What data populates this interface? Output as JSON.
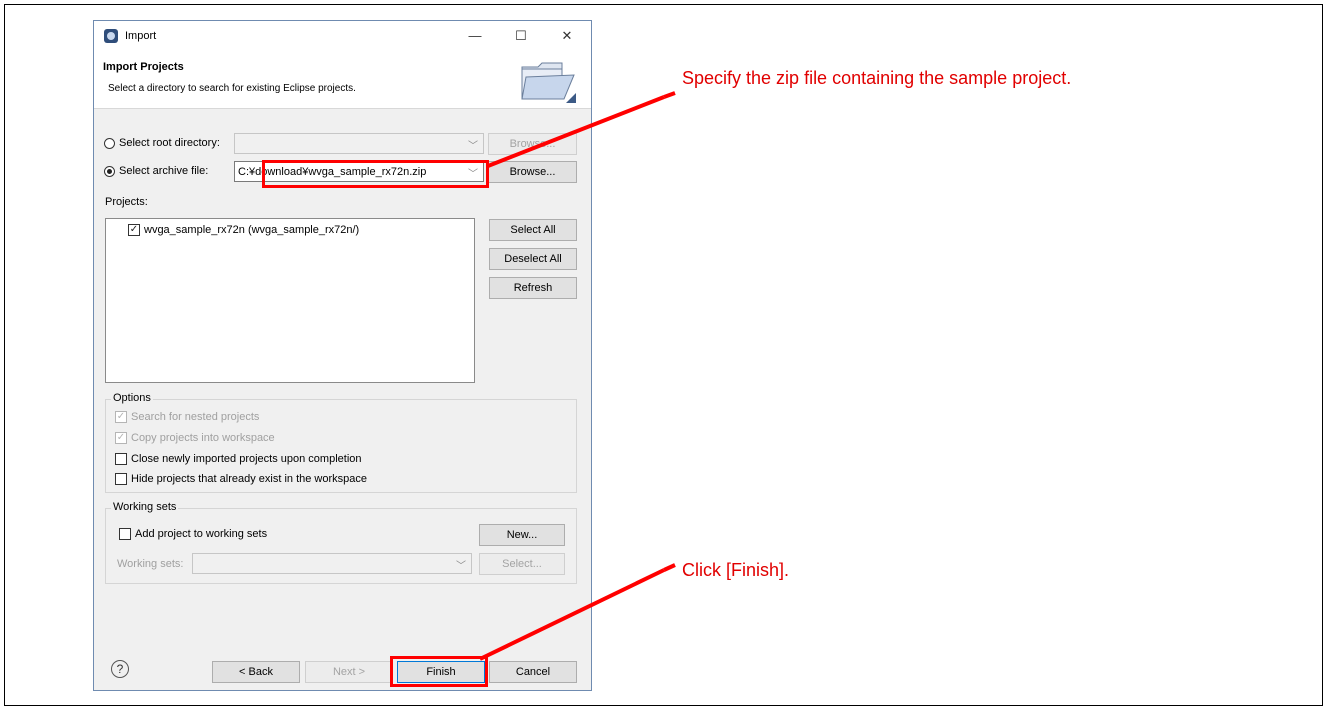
{
  "window": {
    "title": "Import",
    "minimize": "—",
    "maximize": "☐",
    "close": "✕"
  },
  "header": {
    "title": "Import Projects",
    "description": "Select a directory to search for existing Eclipse projects."
  },
  "source": {
    "root_dir_label": "Select root directory:",
    "root_dir_value": "",
    "root_browse": "Browse...",
    "archive_label": "Select archive file:",
    "archive_value": "C:¥download¥wvga_sample_rx72n.zip",
    "archive_browse": "Browse..."
  },
  "projects": {
    "label": "Projects:",
    "items": [
      {
        "label": "wvga_sample_rx72n (wvga_sample_rx72n/)",
        "checked": true
      }
    ],
    "select_all": "Select All",
    "deselect_all": "Deselect All",
    "refresh": "Refresh"
  },
  "options": {
    "title": "Options",
    "items": [
      {
        "label": "Search for nested projects",
        "checked": true,
        "disabled": true
      },
      {
        "label": "Copy projects into workspace",
        "checked": true,
        "disabled": true
      },
      {
        "label": "Close newly imported projects upon completion",
        "checked": false,
        "disabled": false
      },
      {
        "label": "Hide projects that already exist in the workspace",
        "checked": false,
        "disabled": false
      }
    ]
  },
  "working_sets": {
    "title": "Working sets",
    "add_label": "Add project to working sets",
    "new_button": "New...",
    "sets_label": "Working sets:",
    "select_button": "Select..."
  },
  "footer": {
    "help": "?",
    "back": "< Back",
    "next": "Next >",
    "finish": "Finish",
    "cancel": "Cancel"
  },
  "annotations": {
    "zip_note": "Specify the zip file containing the sample project.",
    "finish_note": "Click [Finish]."
  },
  "colors": {
    "highlight": "#ff0000",
    "annotation_text": "#e10000"
  }
}
